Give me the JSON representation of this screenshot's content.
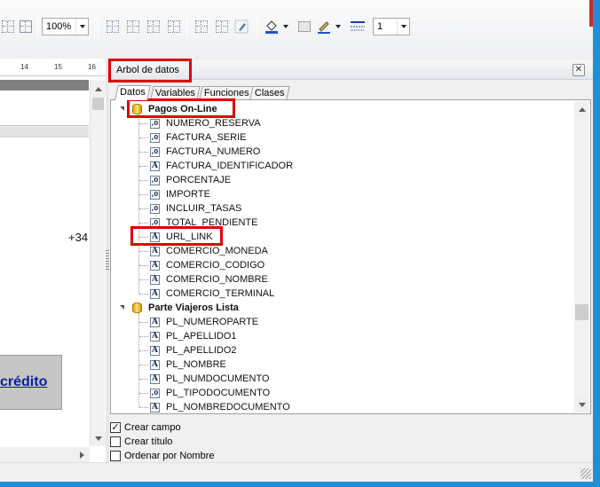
{
  "toolbar": {
    "zoom_value": "100%",
    "line_width_value": "1",
    "icons": [
      "cursor-grid-icon",
      "align-grid-icon",
      "grid-1-icon",
      "grid-2-icon",
      "grid-3-icon",
      "grid-4-icon",
      "grid-5-icon",
      "grid-6-icon",
      "pen-tool-icon",
      "fill-color-icon",
      "color-box-icon",
      "line-color-icon",
      "line-style-icon"
    ]
  },
  "ruler": {
    "numbers": [
      "14",
      "15",
      "16"
    ]
  },
  "canvas": {
    "phone_prefix": "+34",
    "credit_text": "crédito"
  },
  "panel": {
    "title": "Arbol de datos",
    "tabs": [
      "Datos",
      "Variables",
      "Funciones",
      "Clases"
    ],
    "active_tab": "Datos"
  },
  "tree": {
    "groups": [
      {
        "label": "Pagos On-Line",
        "fields": [
          {
            "name": "NUMERO_RESERVA",
            "type": "numeric"
          },
          {
            "name": "FACTURA_SERIE",
            "type": "numeric"
          },
          {
            "name": "FACTURA_NUMERO",
            "type": "numeric"
          },
          {
            "name": "FACTURA_IDENTIFICADOR",
            "type": "text"
          },
          {
            "name": "PORCENTAJE",
            "type": "numeric"
          },
          {
            "name": "IMPORTE",
            "type": "numeric"
          },
          {
            "name": "INCLUIR_TASAS",
            "type": "numeric"
          },
          {
            "name": "TOTAL_PENDIENTE",
            "type": "numeric"
          },
          {
            "name": "URL_LINK",
            "type": "text"
          },
          {
            "name": "COMERCIO_MONEDA",
            "type": "text"
          },
          {
            "name": "COMERCIO_CODIGO",
            "type": "text"
          },
          {
            "name": "COMERCIO_NOMBRE",
            "type": "text"
          },
          {
            "name": "COMERCIO_TERMINAL",
            "type": "text"
          }
        ]
      },
      {
        "label": "Parte Viajeros Lista",
        "fields": [
          {
            "name": "PL_NUMEROPARTE",
            "type": "text"
          },
          {
            "name": "PL_APELLIDO1",
            "type": "text"
          },
          {
            "name": "PL_APELLIDO2",
            "type": "text"
          },
          {
            "name": "PL_NOMBRE",
            "type": "text"
          },
          {
            "name": "PL_NUMDOCUMENTO",
            "type": "text"
          },
          {
            "name": "PL_TIPODOCUMENTO",
            "type": "numeric"
          },
          {
            "name": "PL_NOMBREDOCUMENTO",
            "type": "text"
          }
        ]
      }
    ]
  },
  "options": [
    {
      "label": "Crear campo",
      "checked": true
    },
    {
      "label": "Crear título",
      "checked": false
    },
    {
      "label": "Ordenar por Nombre",
      "checked": false
    }
  ],
  "type_glyphs": {
    "numeric": ",0",
    "text": "A"
  },
  "highlight_color": "#e20000"
}
